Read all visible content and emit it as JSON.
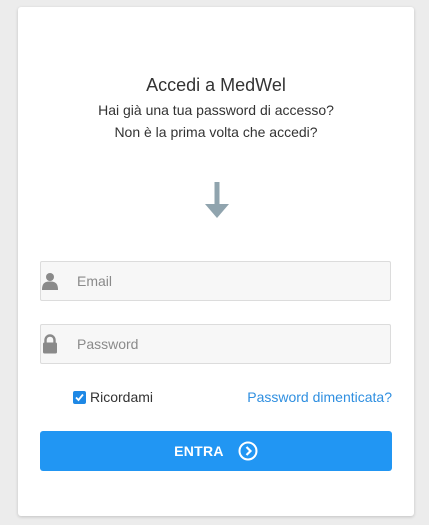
{
  "login": {
    "title": "Accedi a MedWel",
    "subtitle_line1": "Hai già una tua password di accesso?",
    "subtitle_line2": "Non è la prima volta che accedi?"
  },
  "form": {
    "email_placeholder": "Email",
    "email_value": "",
    "password_placeholder": "Password",
    "password_value": "",
    "remember_label": "Ricordami",
    "remember_checked": true,
    "forgot_label": "Password dimenticata?",
    "submit_label": "ENTRA"
  },
  "colors": {
    "accent": "#2196f3",
    "link": "#2f8fe0",
    "arrow": "#90a4ae"
  },
  "icons": {
    "arrow": "arrow-down-icon",
    "email": "user-icon",
    "password": "lock-icon",
    "submit": "chevron-circle-right-icon"
  }
}
